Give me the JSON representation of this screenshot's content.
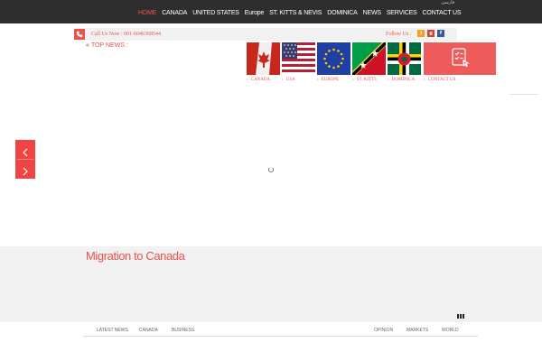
{
  "header": {
    "language_label": "فارسی",
    "nav": [
      {
        "label": "HOME",
        "active": true
      },
      {
        "label": "CANADA",
        "active": false
      },
      {
        "label": "UNITED STATES",
        "active": false
      },
      {
        "label": "Europe",
        "active": false
      },
      {
        "label": "ST. KITTS & NEVIS",
        "active": false
      },
      {
        "label": "DOMINICA",
        "active": false
      },
      {
        "label": "NEWS",
        "active": false
      },
      {
        "label": "SERVICES",
        "active": false
      },
      {
        "label": "CONTACT US",
        "active": false
      }
    ]
  },
  "contact_bar": {
    "phone_text": "Call Us Now : 001-6046368544",
    "follow_text": "Follow Us :",
    "social": [
      "rss-icon",
      "google-plus-icon",
      "facebook-icon"
    ]
  },
  "top_news": {
    "quote": "«",
    "label": "TOP NEWS :"
  },
  "flags": [
    {
      "label": "CANADA",
      "icon": "canada-flag-icon"
    },
    {
      "label": "USA",
      "icon": "usa-flag-icon"
    },
    {
      "label": "EUROPE",
      "icon": "eu-flag-icon"
    },
    {
      "label": "ST. KITTS",
      "icon": "st-kitts-flag-icon"
    },
    {
      "label": "DOMINICA",
      "icon": "dominica-flag-icon"
    },
    {
      "label": "CONTACT US",
      "icon": "checklist-icon"
    }
  ],
  "section": {
    "title": "Migration to Canada"
  },
  "bottom_tabs": [
    "LATEST NEWS",
    "CANADA",
    "BUSINESS",
    "OPINION",
    "MARKETS",
    "WORLD"
  ],
  "colors": {
    "accent": "#e8534f",
    "topbar": "#2e2e2e",
    "contact_tile": "#ef5b5b",
    "slider_arrow": "#ef4444",
    "gray_section": "#f1f1f1"
  }
}
